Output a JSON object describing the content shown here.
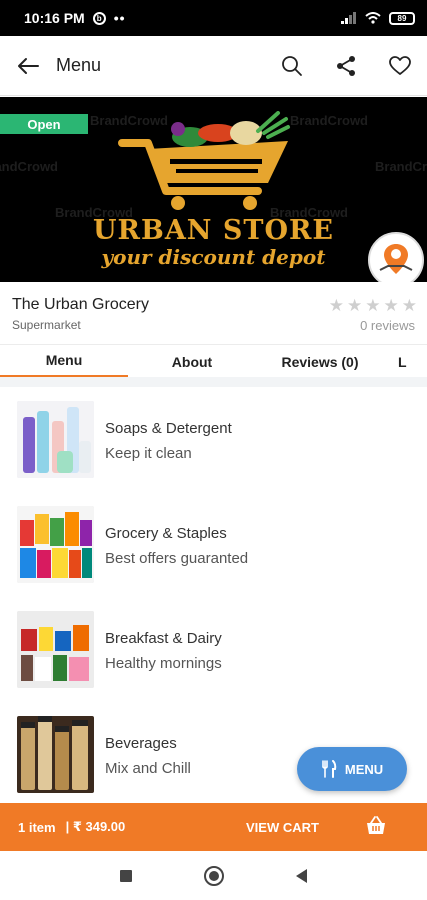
{
  "status_bar": {
    "time": "10:16 PM",
    "dots": "••",
    "battery": "89"
  },
  "app_bar": {
    "title": "Menu"
  },
  "banner": {
    "open_label": "Open",
    "store_title": "URBAN STORE",
    "tagline": "your discount depot",
    "watermark": "BrandCrowd"
  },
  "store": {
    "name": "The Urban Grocery",
    "type": "Supermarket",
    "rating": 0,
    "reviews_label": "0 reviews"
  },
  "tabs": [
    {
      "label": "Menu",
      "active": true
    },
    {
      "label": "About",
      "active": false
    },
    {
      "label": "Reviews (0)",
      "active": false
    },
    {
      "label": "L",
      "active": false
    }
  ],
  "categories": [
    {
      "title": "Soaps & Detergent",
      "subtitle": "Keep it clean"
    },
    {
      "title": "Grocery & Staples",
      "subtitle": "Best offers guaranted"
    },
    {
      "title": "Breakfast & Dairy",
      "subtitle": "Healthy mornings"
    },
    {
      "title": "Beverages",
      "subtitle": "Mix and Chill"
    }
  ],
  "fab": {
    "label": "MENU"
  },
  "cart_bar": {
    "count": "1 item",
    "price": "| ₹ 349.00",
    "action": "VIEW CART"
  },
  "colors": {
    "accent": "#f07a26",
    "open_green": "#2bb673",
    "fab_blue": "#4a90d9",
    "logo_gold": "#e6a52e"
  }
}
